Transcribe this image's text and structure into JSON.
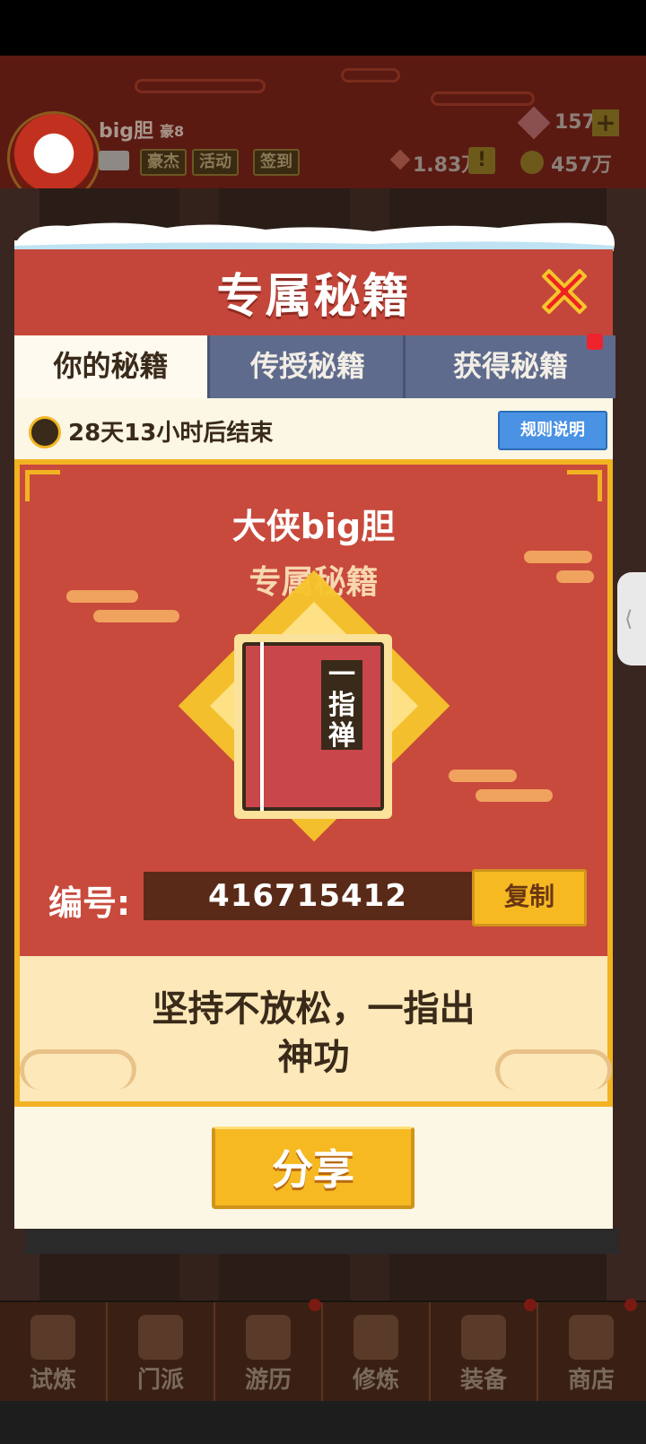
{
  "player": {
    "name": "big胆",
    "title": "豪8",
    "tags": [
      "豪杰",
      "活动",
      "签到"
    ],
    "gem_count": "1571",
    "resource_count": "1.83万",
    "coin_count": "457万"
  },
  "modal": {
    "title": "专属秘籍",
    "tabs": [
      "你的秘籍",
      "传授秘籍",
      "获得秘籍"
    ],
    "active_tab": 0,
    "timer_text": "28天13小时后结束",
    "rules_button": "规则说明",
    "hero_name": "大侠big胆",
    "subtitle": "专属秘籍",
    "book_title": "一指禅",
    "serial_label": "编号:",
    "serial_number": "416715412",
    "copy_button": "复制",
    "motto_line1": "坚持不放松，一指出",
    "motto_line2": "神功",
    "share_button": "分享"
  },
  "bottom_nav": [
    "试炼",
    "门派",
    "游历",
    "修炼",
    "装备",
    "商店"
  ],
  "colors": {
    "header_red": "#c4463a",
    "panel_red": "#c84a3c",
    "gold": "#f2b322",
    "tab_blue": "#5f6b8c",
    "rules_blue": "#4a92e4",
    "close_red": "#ee2222"
  },
  "icons": {
    "close": "close-x-icon",
    "timer": "clock-icon",
    "book": "book-icon"
  }
}
